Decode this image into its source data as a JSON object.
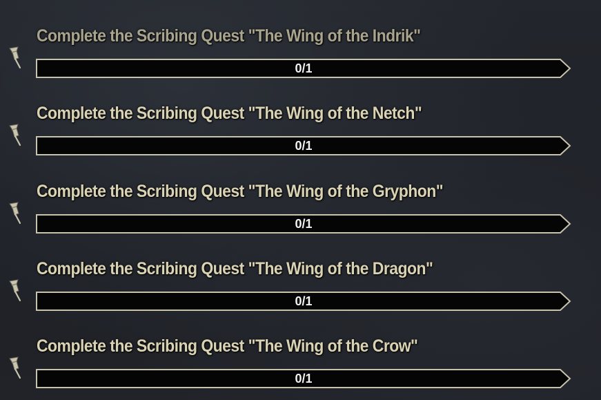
{
  "colors": {
    "title": "#d9d2b3",
    "title_dim": "#a9a48e",
    "bar_border": "#c8c3ad",
    "bar_bg": "#050505",
    "progress_text": "#f2f2f2"
  },
  "tracked_icon": "pushpin-icon",
  "objectives": [
    {
      "title": "Complete the Scribing Quest \"The Wing of the Indrik\"",
      "progress_text": "0/1",
      "current": 0,
      "max": 1,
      "dimmed": true
    },
    {
      "title": "Complete the Scribing Quest \"The Wing of the Netch\"",
      "progress_text": "0/1",
      "current": 0,
      "max": 1,
      "dimmed": false
    },
    {
      "title": "Complete the Scribing Quest \"The Wing of the Gryphon\"",
      "progress_text": "0/1",
      "current": 0,
      "max": 1,
      "dimmed": false
    },
    {
      "title": "Complete the Scribing Quest \"The Wing of the Dragon\"",
      "progress_text": "0/1",
      "current": 0,
      "max": 1,
      "dimmed": false
    },
    {
      "title": "Complete the Scribing Quest \"The Wing of the Crow\"",
      "progress_text": "0/1",
      "current": 0,
      "max": 1,
      "dimmed": false
    }
  ]
}
